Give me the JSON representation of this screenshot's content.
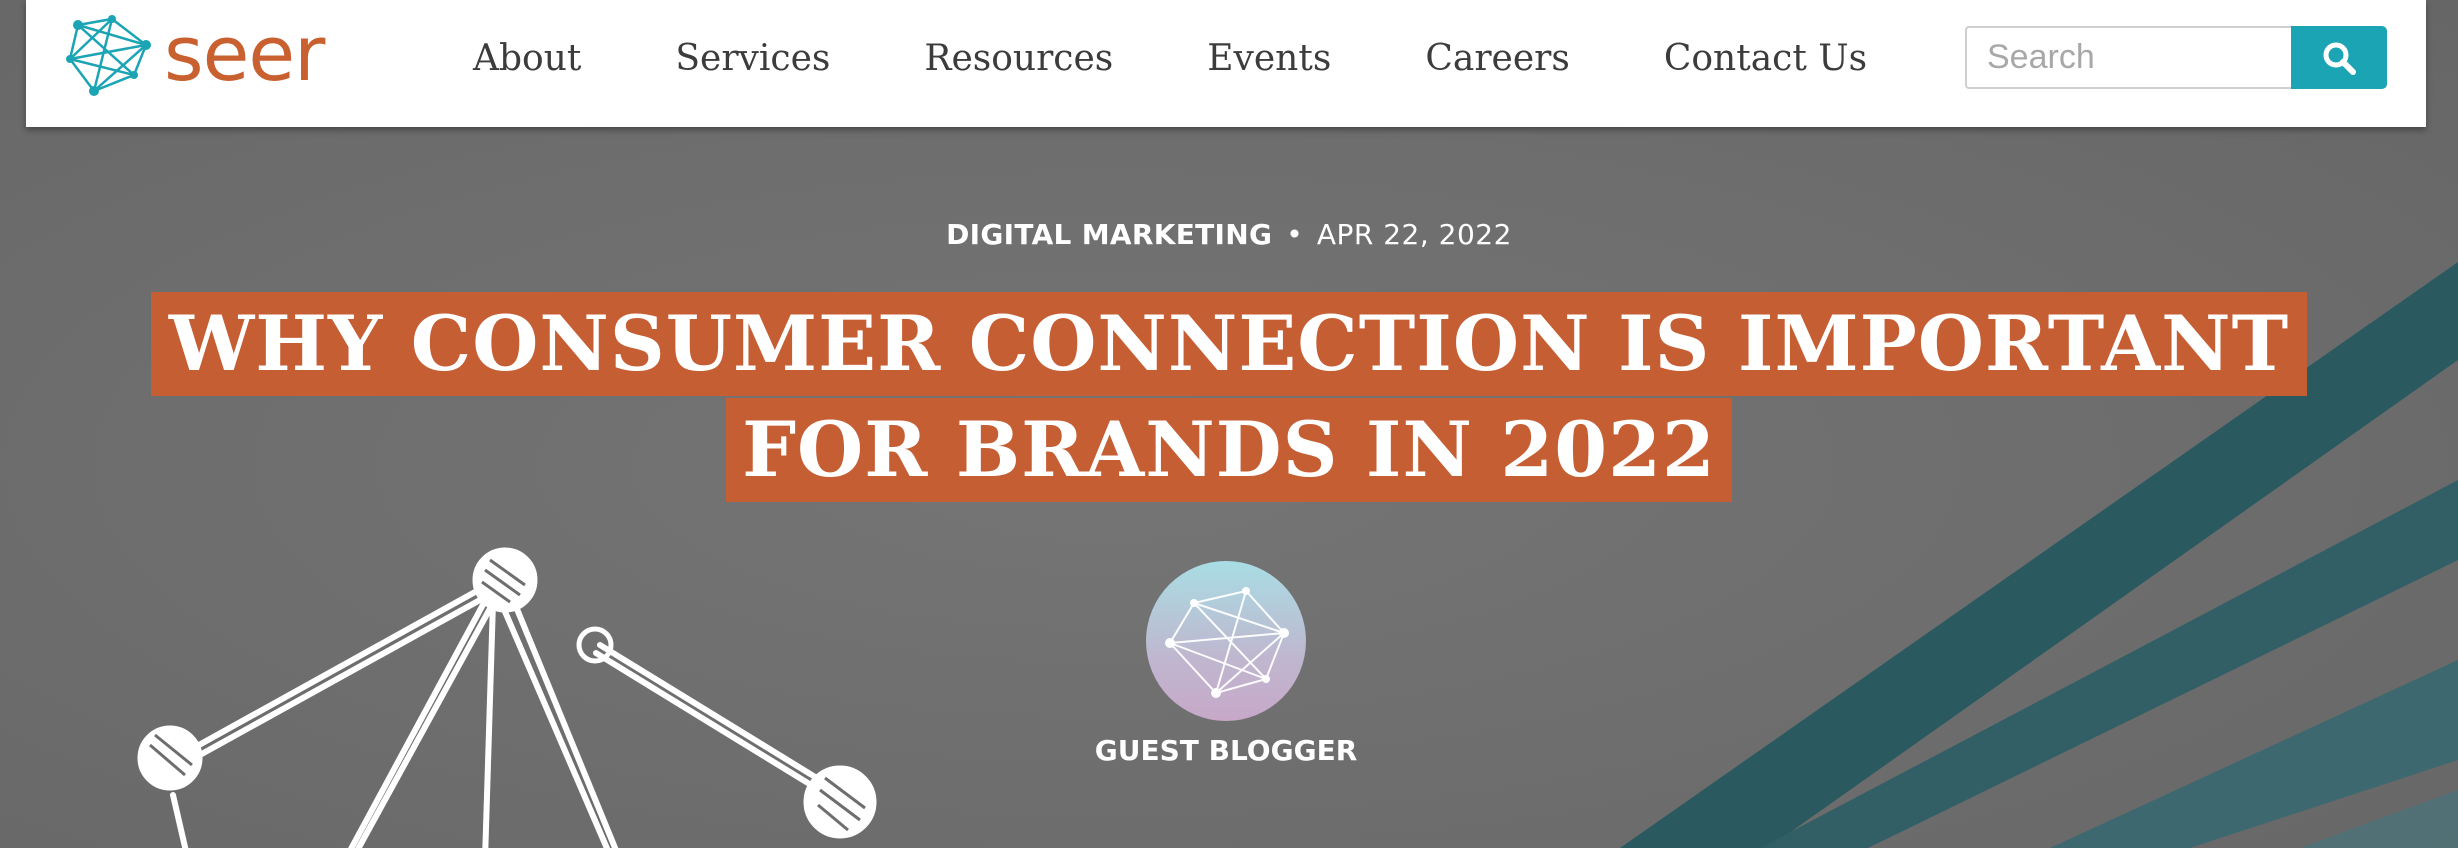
{
  "brand": {
    "name": "seer",
    "logo_icon": "network-logo-icon",
    "accent_color": "#c9602f",
    "teal_color": "#1aa4b4"
  },
  "nav": {
    "items": [
      {
        "label": "About"
      },
      {
        "label": "Services"
      },
      {
        "label": "Resources"
      },
      {
        "label": "Events"
      },
      {
        "label": "Careers"
      },
      {
        "label": "Contact Us"
      }
    ]
  },
  "search": {
    "placeholder": "Search",
    "value": "",
    "button_icon": "search-icon"
  },
  "article": {
    "category": "DIGITAL MARKETING",
    "separator": "•",
    "date": "APR 22, 2022",
    "title_line_1": "WHY CONSUMER CONNECTION IS IMPORTANT",
    "title_line_2": "FOR BRANDS IN 2022",
    "title_bg_color": "#c65e34",
    "author": {
      "name": "GUEST BLOGGER",
      "avatar_icon": "network-avatar-icon"
    }
  }
}
